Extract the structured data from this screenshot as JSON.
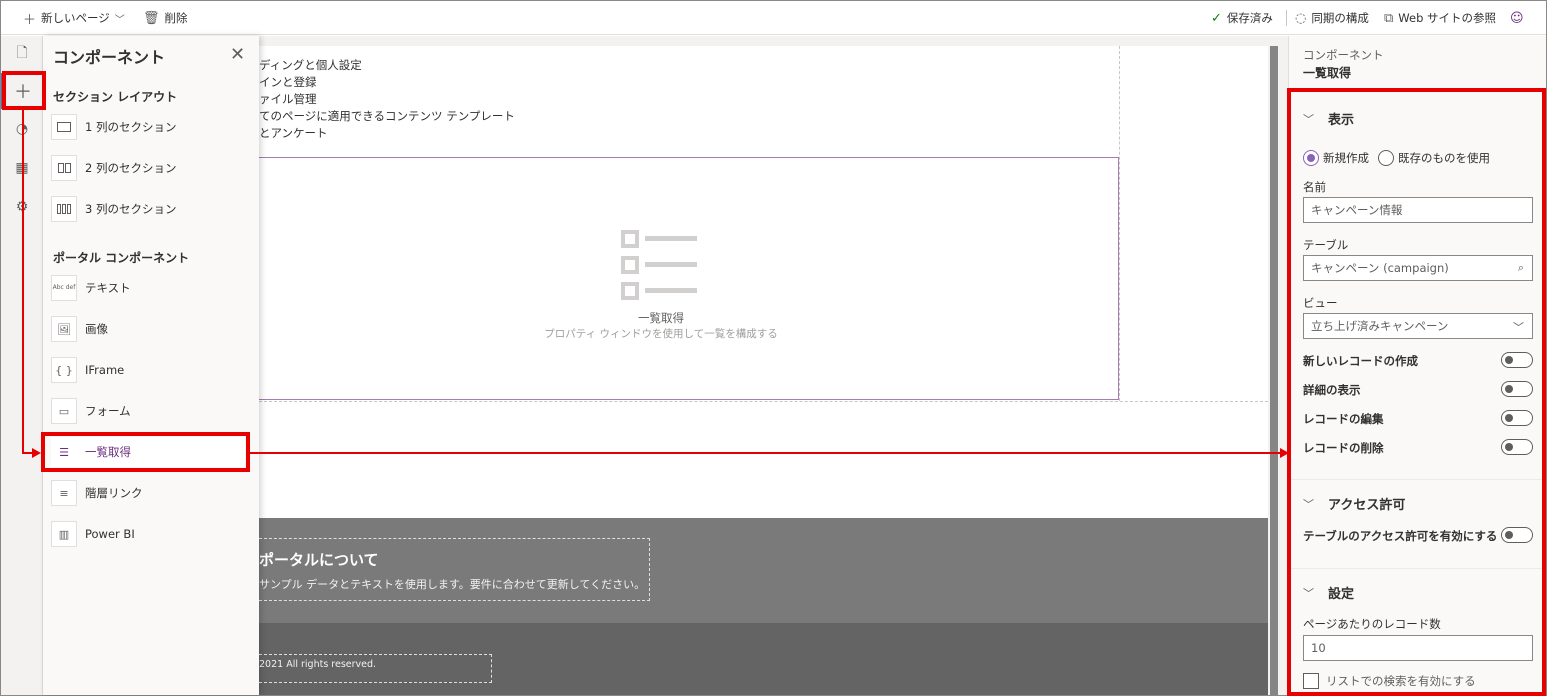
{
  "toolbar": {
    "new_page": "新しいページ",
    "delete": "削除",
    "saved": "保存済み",
    "sync": "同期の構成",
    "browse": "Web サイトの参照"
  },
  "components_panel": {
    "title": "コンポーネント",
    "section_layout_heading": "セクション レイアウト",
    "layouts": [
      "1 列のセクション",
      "2 列のセクション",
      "3 列のセクション"
    ],
    "portal_heading": "ポータル コンポーネント",
    "components": [
      "テキスト",
      "画像",
      "IFrame",
      "フォーム",
      "一覧取得",
      "階層リンク",
      "Power BI"
    ],
    "text_icon_glyph": "Abc def"
  },
  "canvas": {
    "nav_lines": [
      "ディングと個人設定",
      "インと登録",
      "ァイル管理",
      "てのページに適用できるコンテンツ テンプレート",
      "とアンケート"
    ],
    "list_label": "一覧取得",
    "list_hint": "プロパティ ウィンドウを使用して一覧を構成する",
    "about_title": "ポータルについて",
    "about_text": "サンプル データとテキストを使用します。要件に合わせて更新してください。",
    "copyright": "2021 All rights reserved."
  },
  "properties": {
    "header": "コンポーネント",
    "component_name": "一覧取得",
    "display_group": "表示",
    "radio_new": "新規作成",
    "radio_existing": "既存のものを使用",
    "name_label": "名前",
    "name_placeholder": "キャンペーン情報",
    "table_label": "テーブル",
    "table_value": "キャンペーン (campaign)",
    "view_label": "ビュー",
    "view_value": "立ち上げ済みキャンペーン",
    "toggles": [
      "新しいレコードの作成",
      "詳細の表示",
      "レコードの編集",
      "レコードの削除"
    ],
    "access_group": "アクセス許可",
    "access_toggle": "テーブルのアクセス許可を有効にする",
    "settings_group": "設定",
    "records_per_page_label": "ページあたりのレコード数",
    "records_per_page_value": "10",
    "search_checkbox": "リストでの検索を有効にする"
  },
  "colors": {
    "accent_purple": "#8764b8",
    "annotation_red": "#e60000"
  }
}
